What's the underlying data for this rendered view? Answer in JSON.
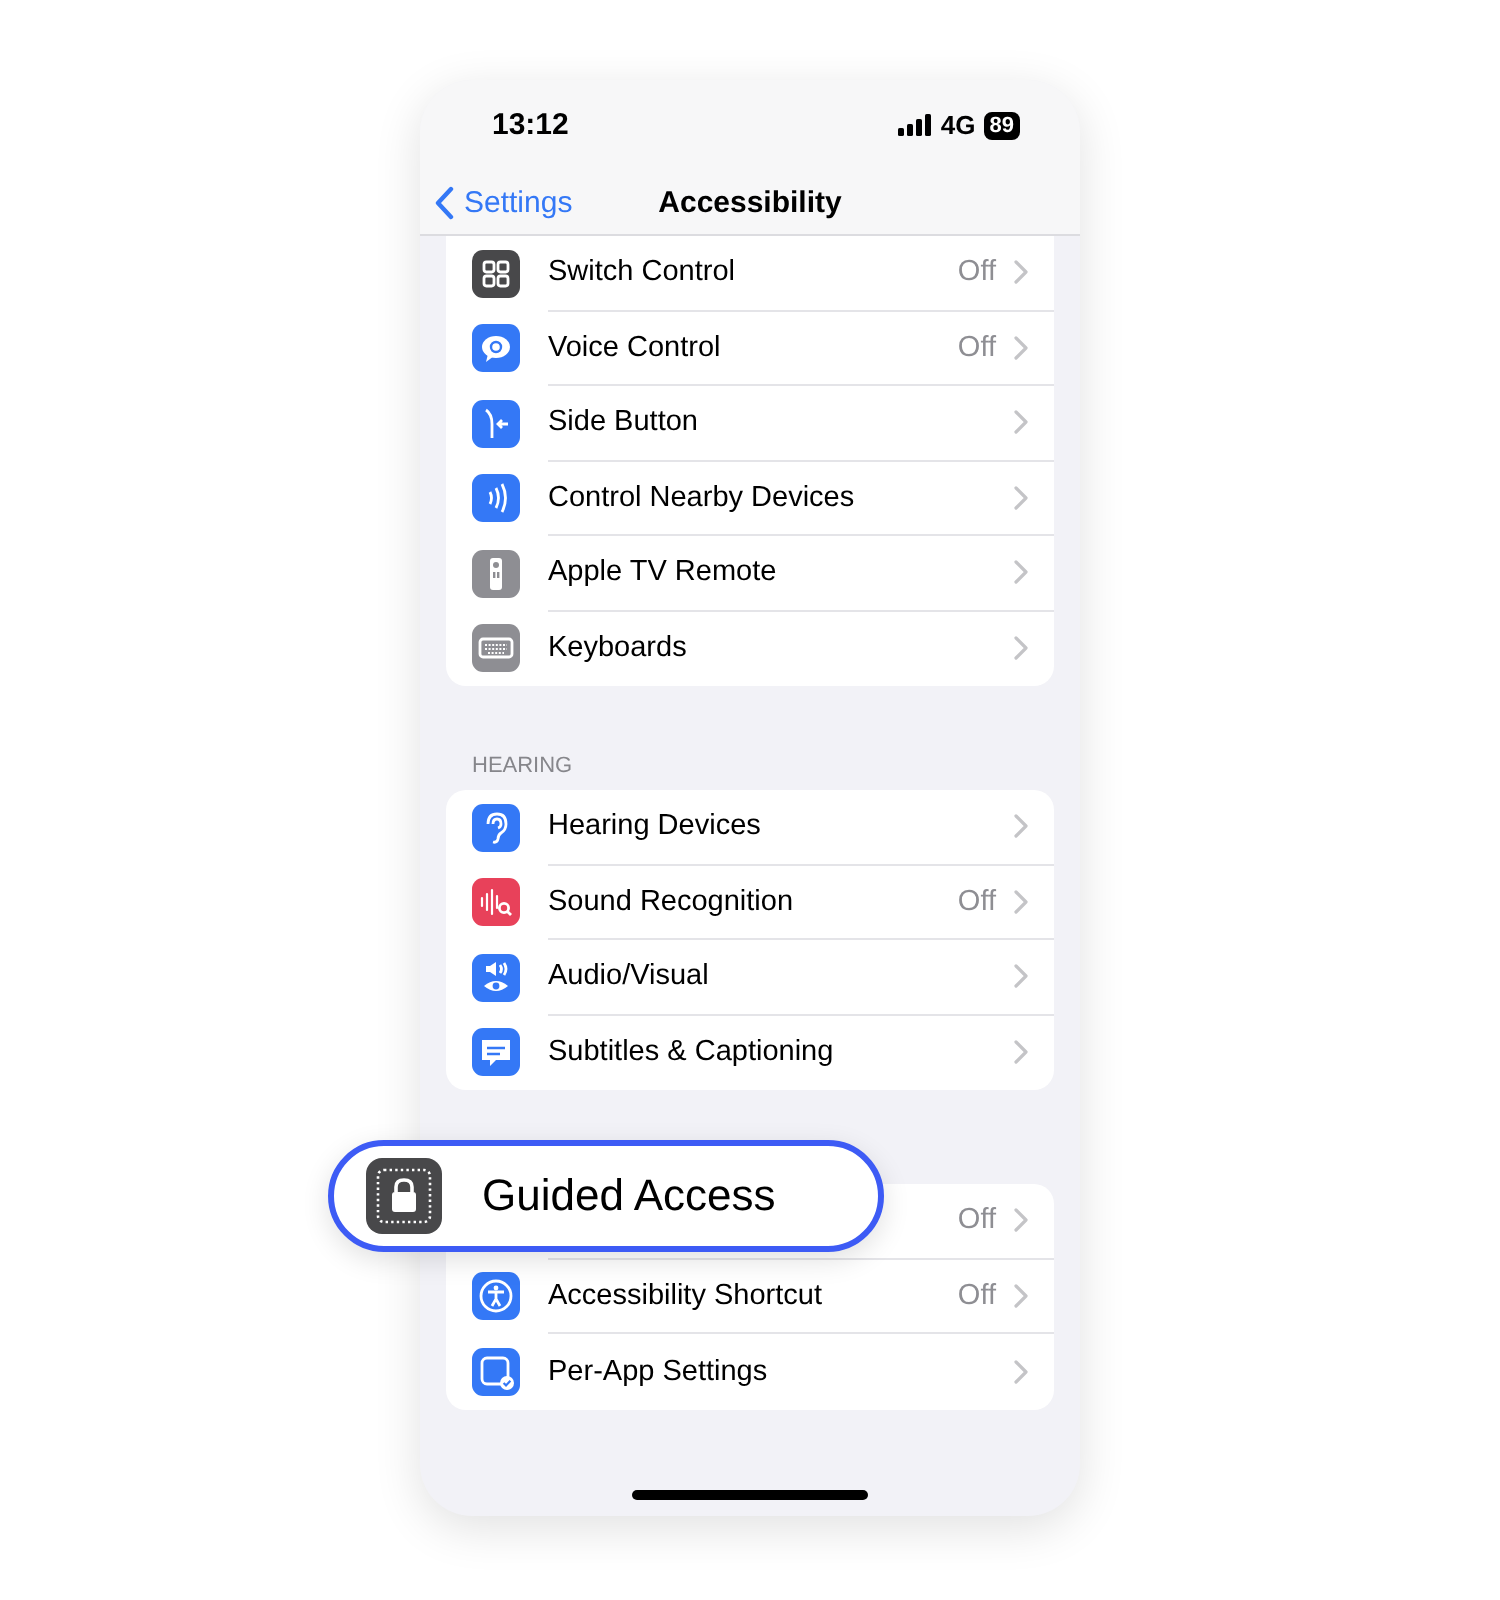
{
  "status_bar": {
    "time": "13:12",
    "network": "4G",
    "battery": "89"
  },
  "nav_bar": {
    "back": "Settings",
    "title": "Accessibility"
  },
  "sections": [
    {
      "rows": [
        {
          "label": "Switch Control",
          "value": "Off"
        },
        {
          "label": "Voice Control",
          "value": "Off"
        },
        {
          "label": "Side Button"
        },
        {
          "label": "Control Nearby Devices"
        },
        {
          "label": "Apple TV Remote"
        },
        {
          "label": "Keyboards"
        }
      ]
    },
    {
      "header": "HEARING",
      "rows": [
        {
          "label": "Hearing Devices"
        },
        {
          "label": "Sound Recognition",
          "value": "Off"
        },
        {
          "label": "Audio/Visual"
        },
        {
          "label": "Subtitles & Captioning"
        }
      ]
    },
    {
      "rows": [
        {
          "value": "Off"
        },
        {
          "label": "Accessibility Shortcut",
          "value": "Off"
        },
        {
          "label": "Per-App Settings"
        }
      ]
    }
  ],
  "callout": {
    "label": "Guided Access"
  }
}
